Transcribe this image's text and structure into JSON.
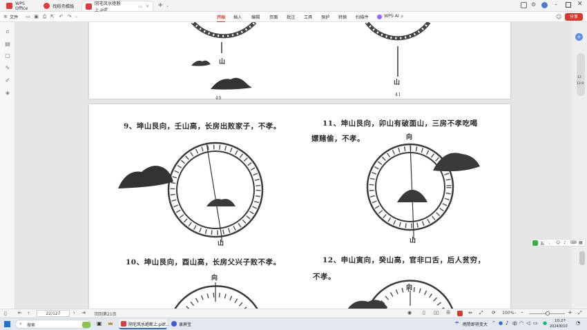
{
  "titlebar": {
    "tabs": [
      {
        "label": "WPS Office",
        "color": "#e0393e"
      },
      {
        "label": "找稻壳模板",
        "color": "#e0393e"
      },
      {
        "label": "阴宅风水绝断上.pdf",
        "color": "#e0393e"
      }
    ],
    "add_tab": "+"
  },
  "toolbar": {
    "file_menu": "文件",
    "menus": [
      "开始",
      "插入",
      "编辑",
      "页面",
      "批注",
      "工具",
      "保护",
      "转换",
      "扫描件",
      "WPS AI"
    ],
    "share_label": "分享",
    "accent": "#d43b2c"
  },
  "document": {
    "page_top": {
      "left_page_number": "40",
      "right_page_number": "41",
      "left_mountain_label": "山",
      "right_mountain_label": "山"
    },
    "page_main": {
      "item9": "9、坤山艮向，壬山高，长房出败家子，不孝。",
      "item11_line1": "11、坤山艮向，卯山有破面山，三房不孝吃喝",
      "item11_line2": "嫖赌偷，不孝。",
      "item10": "10、坤山艮向，酉山高，长房父兴子败不孝。",
      "item12_line1": "12、申山寅向，癸山高，官非口舌，后人贫穷，",
      "item12_line2": "不孝。",
      "compass_top_label": "向",
      "compass_bottom_label": "山"
    }
  },
  "rightrail": {
    "zoom_badge_top": "12",
    "zoom_badge_bottom": "13.9",
    "ime_label": "五"
  },
  "statusbar": {
    "page_input": "22/127",
    "back_label": "回到第21页",
    "zoom": "100%"
  },
  "taskbar": {
    "search_placeholder": "搜索",
    "app1": "阴宅风水绝断上.pdf...",
    "app2": "录屏宝",
    "weather": "雨势即将变大",
    "time": "10:27",
    "date": "2024/6/10"
  }
}
